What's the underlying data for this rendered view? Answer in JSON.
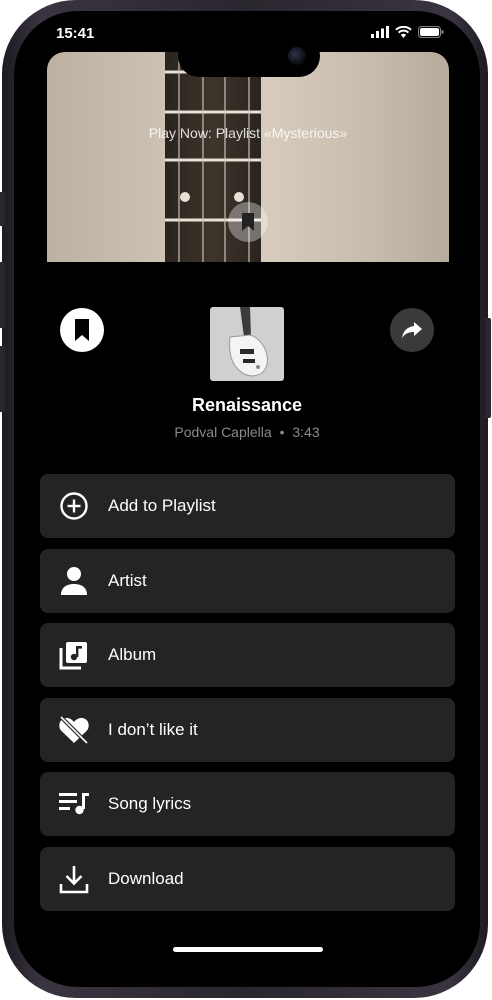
{
  "status_bar": {
    "time": "15:41"
  },
  "banner": {
    "title": "Play Now: Playlist «Mysterious»"
  },
  "track": {
    "title": "Renaissance",
    "artist": "Podval Caplella",
    "separator": "•",
    "duration": "3:43"
  },
  "menu": [
    {
      "label": "Add to Playlist",
      "icon": "add-circle-icon"
    },
    {
      "label": "Artist",
      "icon": "person-icon"
    },
    {
      "label": "Album",
      "icon": "album-icon"
    },
    {
      "label": "I don’t like it",
      "icon": "heart-crossed-icon"
    },
    {
      "label": "Song lyrics",
      "icon": "lyrics-icon"
    },
    {
      "label": "Download",
      "icon": "download-icon"
    }
  ],
  "colors": {
    "screen_bg": "#000000",
    "item_bg": "#242424",
    "text": "#ffffff",
    "muted": "#8a8a8a"
  }
}
